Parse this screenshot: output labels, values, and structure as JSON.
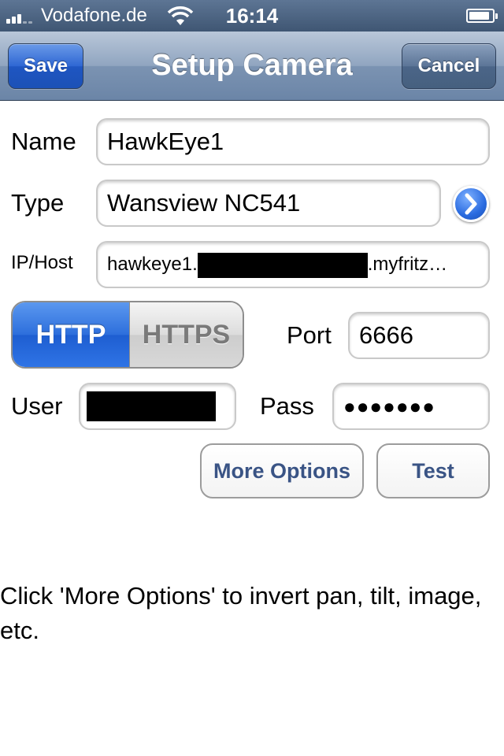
{
  "status_bar": {
    "carrier": "Vodafone.de",
    "time": "16:14",
    "signal_bars": 3,
    "signal_bars_total": 5,
    "battery_level": 0.9,
    "icons": [
      "signal-icon",
      "wifi-icon",
      "battery-icon"
    ]
  },
  "nav": {
    "title": "Setup Camera",
    "save_label": "Save",
    "cancel_label": "Cancel"
  },
  "form": {
    "name_label": "Name",
    "name_value": "HawkEye1",
    "type_label": "Type",
    "type_value": "Wansview NC541",
    "host_label": "IP/Host",
    "host_prefix": "hawkeye1.",
    "host_suffix": ".myfritz…",
    "protocol_options": [
      "HTTP",
      "HTTPS"
    ],
    "protocol_selected": "HTTP",
    "port_label": "Port",
    "port_value": "6666",
    "user_label": "User",
    "pass_label": "Pass",
    "pass_value": "●●●●●●●"
  },
  "actions": {
    "more_options_label": "More Options",
    "test_label": "Test"
  },
  "hint_text": "Click 'More Options' to invert pan, tilt, image, etc.",
  "colors": {
    "nav_accent": "#6b85a7",
    "save_button": "#2f67d3",
    "selected_segment": "#2d6fdc",
    "button_text": "#3a5485"
  }
}
